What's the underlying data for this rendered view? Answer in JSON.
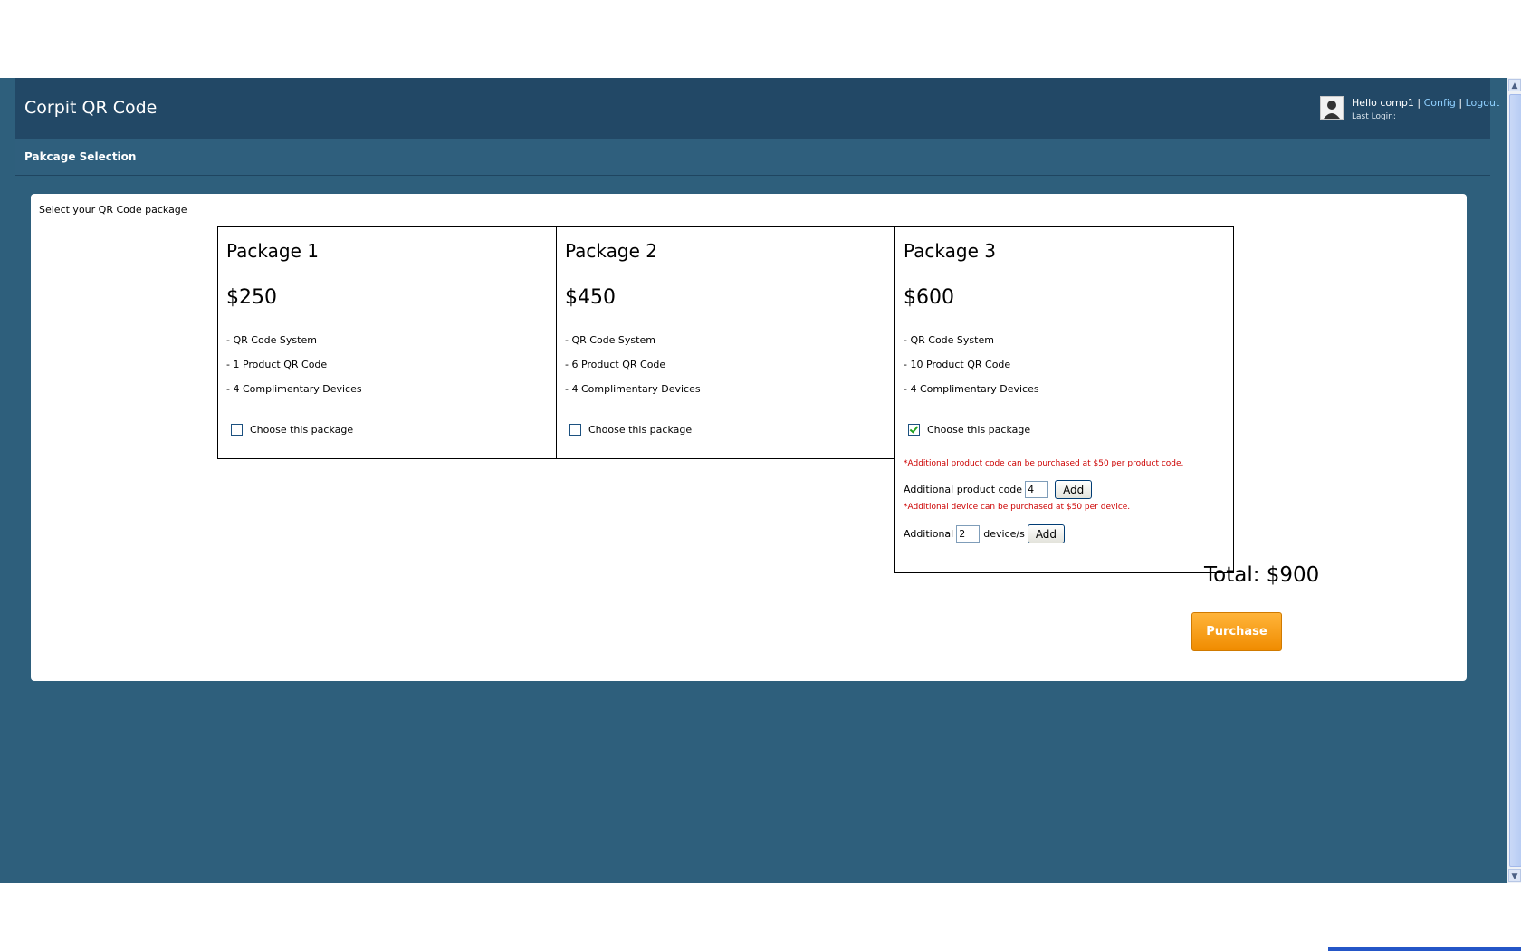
{
  "header": {
    "app_title": "Corpit QR Code",
    "greeting": "Hello comp1",
    "config_link": "Config",
    "logout_link": "Logout",
    "separator": "|",
    "last_login": "Last Login:"
  },
  "subheader": {
    "title": "Pakcage Selection"
  },
  "content": {
    "intro": "Select your QR Code package",
    "packages": [
      {
        "name": "Package 1",
        "price": "$250",
        "features": [
          "- QR Code System",
          "- 1 Product QR Code",
          "- 4 Complimentary Devices"
        ],
        "choose_label": "Choose this package",
        "selected": false
      },
      {
        "name": "Package 2",
        "price": "$450",
        "features": [
          "- QR Code System",
          "- 6 Product QR Code",
          "- 4 Complimentary Devices"
        ],
        "choose_label": "Choose this package",
        "selected": false
      },
      {
        "name": "Package 3",
        "price": "$600",
        "features": [
          "- QR Code System",
          "- 10 Product QR Code",
          "- 4 Complimentary Devices"
        ],
        "choose_label": "Choose this package",
        "selected": true
      }
    ],
    "extras": {
      "product_note": "*Additional product code can be purchased at $50 per product code.",
      "product_label": "Additional product code",
      "product_qty": "4",
      "device_note": "*Additional device can be purchased at $50 per device.",
      "device_label": "Additional",
      "device_qty": "2",
      "device_suffix": "device/s",
      "add_label": "Add"
    },
    "total": "Total: $900",
    "purchase_label": "Purchase"
  },
  "colors": {
    "header_bg": "#224866",
    "page_bg": "#2e5f7c",
    "link": "#8fd0ff",
    "note": "#cc0000",
    "purchase": "#f59a12"
  }
}
